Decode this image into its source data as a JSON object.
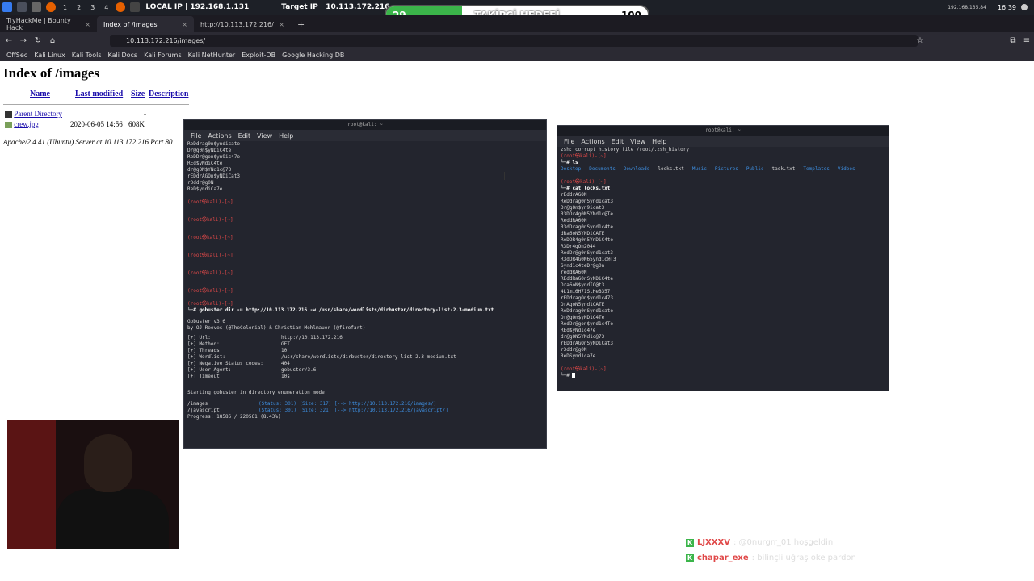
{
  "taskbar": {
    "workspaces": [
      "1",
      "2",
      "3",
      "4"
    ],
    "local_ip_label": "LOCAL IP | 192.168.1.131",
    "target_ip_label": "Target IP | 10.113.172.216",
    "vpn_ip_label": "192.168.135.84",
    "clock": "16:39"
  },
  "follower_goal": {
    "count": "29",
    "title": "TAKİPÇİ HEDEFİ",
    "goal": "100",
    "fraction": 0.29
  },
  "browser": {
    "tabs": [
      {
        "label": "TryHackMe | Bounty Hack"
      },
      {
        "label": "Index of /images"
      },
      {
        "label": "http://10.113.172.216/"
      }
    ],
    "url": "10.113.172.216/images/",
    "bookmarks": [
      "OffSec",
      "Kali Linux",
      "Kali Tools",
      "Kali Docs",
      "Kali Forums",
      "Kali NetHunter",
      "Exploit-DB",
      "Google Hacking DB"
    ]
  },
  "page": {
    "title": "Index of /images",
    "columns": {
      "name": "Name",
      "modified": "Last modified",
      "size": "Size",
      "description": "Description"
    },
    "rows": [
      {
        "name": "Parent Directory",
        "modified": "",
        "size": "-"
      },
      {
        "name": "crew.jpg",
        "modified": "2020-06-05 14:56",
        "size": "608K"
      }
    ],
    "footer": "Apache/2.4.41 (Ubuntu) Server at 10.113.172.216 Port 80"
  },
  "terminal_left": {
    "title": "root@kali: ~",
    "menu": [
      "File",
      "Actions",
      "Edit",
      "View",
      "Help"
    ],
    "top_lines": [
      "ReDdrag0n$yndicate",
      "Dr@g0n$yNDiC4te",
      "ReDDr@gon$yn9ic47e",
      "REd$yNdiC4te",
      "dr@gON$YNd1c@73",
      "rEDdrAGOn$yNDiCat3",
      "r3ddr@g0N",
      "ReD$yndiCa7e"
    ],
    "prompt": "(root㉿kali)-[~]",
    "command": "gobuster dir -u http://10.113.172.216 -w /usr/share/wordlists/dirbuster/directory-list-2.3-medium.txt",
    "banner": [
      "Gobuster v3.6",
      "by OJ Reeves (@TheColonial) & Christian Mehlmauer (@firefart)"
    ],
    "config": [
      [
        "[+] Url:",
        "http://10.113.172.216"
      ],
      [
        "[+] Method:",
        "GET"
      ],
      [
        "[+] Threads:",
        "10"
      ],
      [
        "[+] Wordlist:",
        "/usr/share/wordlists/dirbuster/directory-list-2.3-medium.txt"
      ],
      [
        "[+] Negative Status codes:",
        "404"
      ],
      [
        "[+] User Agent:",
        "gobuster/3.6"
      ],
      [
        "[+] Timeout:",
        "10s"
      ]
    ],
    "starting": "Starting gobuster in directory enumeration mode",
    "results": [
      [
        "/images",
        "(Status: 301) [Size: 317] [--> http://10.113.172.216/images/]"
      ],
      [
        "/javascript",
        "(Status: 301) [Size: 321] [--> http://10.113.172.216/javascript/]"
      ]
    ],
    "progress": "Progress: 18586 / 220561 (8.43%)"
  },
  "terminal_right": {
    "title": "root@kali: ~",
    "menu": [
      "File",
      "Actions",
      "Edit",
      "View",
      "Help"
    ],
    "history_error": "zsh: corrupt history file /root/.zsh_history",
    "prompt": "(root㉿kali)-[~]",
    "cmd_ls": "ls",
    "ls_dirs": [
      "Desktop",
      "Documents",
      "Downloads",
      "Music",
      "Pictures",
      "Public",
      "Templates",
      "Videos"
    ],
    "ls_files": [
      "locks.txt",
      "task.txt"
    ],
    "cmd_cat": "cat locks.txt",
    "locks": [
      "rEddrAGON",
      "ReDdrag0nSynd1cat3",
      "Dr@gOn$yn9icat3",
      "R3DDr4g0N5YNd1c@Te",
      "ReddRA60N",
      "R3dDrag0nSynd1c4te",
      "dRa6oN5YNDiCATE",
      "ReDDR4g0n5YnDiC4te",
      "R3Dr4gOn2044",
      "RedDr@g0nSynd1cat3",
      "R3dDR4G0N65ynd1c@T3",
      "Synd1c4teDr@g0n",
      "reddRA60N",
      "REddRaG0nSyNDiC4te",
      "Dra6oN$yndIC@t3",
      "4L1mi6H71StHeB357",
      "rEDdragOn$ynd1c473",
      "DrAgoN5ynd1CATE",
      "ReDdrag0nSynd1cate",
      "Dr@gOn$yND1C4Te",
      "RedDr@gon$ynd1c4Te",
      "REd$yNdIc47e",
      "dr@gON5YNd1c@73",
      "rEDdrAGOnSyNDiCat3",
      "r3ddr@g0N",
      "ReDSynd1ca7e"
    ]
  },
  "chat": [
    {
      "user": "LJXXXV",
      "message": ": @0nurgrr_01 hoşgeldin"
    },
    {
      "user": "chapar_exe",
      "message": ": bilinçli uğraş oke pardon"
    }
  ]
}
